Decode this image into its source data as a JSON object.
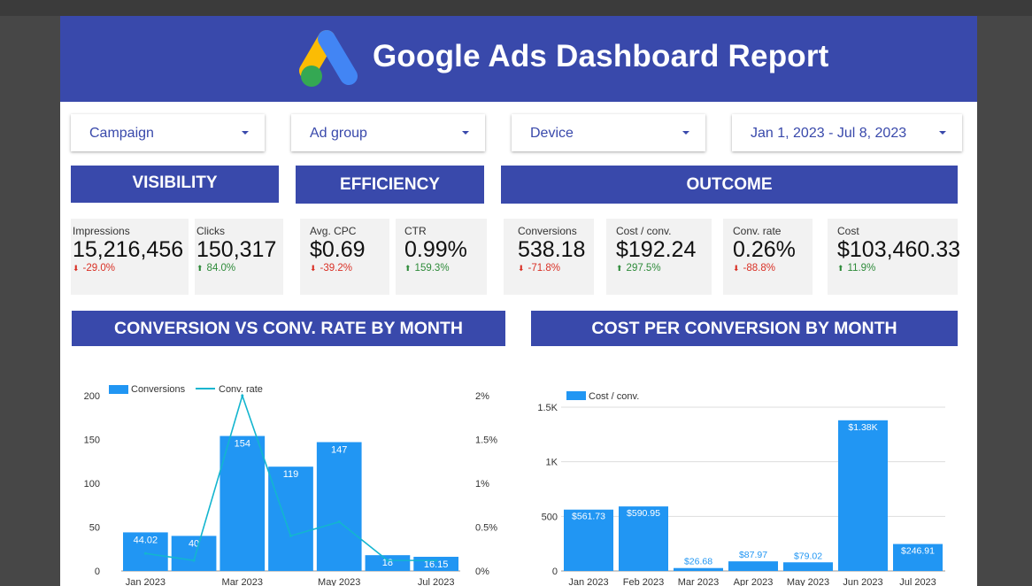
{
  "header": {
    "title": "Google Ads Dashboard Report",
    "logo": "google-ads-logo"
  },
  "filters": [
    {
      "label": "Campaign"
    },
    {
      "label": "Ad group"
    },
    {
      "label": "Device"
    },
    {
      "label": "Jan 1, 2023 - Jul 8, 2023"
    }
  ],
  "sections": {
    "visibility": "VISIBILITY",
    "efficiency": "EFFICIENCY",
    "outcome": "OUTCOME"
  },
  "kpis": [
    {
      "label": "Impressions",
      "value": "15,216,456",
      "delta": "-29.0%",
      "dir": "down"
    },
    {
      "label": "Clicks",
      "value": "150,317",
      "delta": "84.0%",
      "dir": "up"
    },
    {
      "label": "Avg. CPC",
      "value": "$0.69",
      "delta": "-39.2%",
      "dir": "down"
    },
    {
      "label": "CTR",
      "value": "0.99%",
      "delta": "159.3%",
      "dir": "up"
    },
    {
      "label": "Conversions",
      "value": "538.18",
      "delta": "-71.8%",
      "dir": "down"
    },
    {
      "label": "Cost / conv.",
      "value": "$192.24",
      "delta": "297.5%",
      "dir": "up"
    },
    {
      "label": "Conv. rate",
      "value": "0.26%",
      "delta": "-88.8%",
      "dir": "down"
    },
    {
      "label": "Cost",
      "value": "$103,460.33",
      "delta": "11.9%",
      "dir": "up"
    }
  ],
  "colors": {
    "brand": "#3949ab",
    "bar": "#2196f3",
    "line": "#13b5cf",
    "up": "#2e8b3a",
    "down": "#d93025"
  },
  "chart_data": [
    {
      "type": "bar",
      "title": "CONVERSION VS CONV. RATE BY MONTH",
      "categories": [
        "Jan 2023",
        "Feb 2023",
        "Mar 2023",
        "Apr 2023",
        "May 2023",
        "Jun 2023",
        "Jul 2023"
      ],
      "series": [
        {
          "name": "Conversions",
          "type": "bar",
          "axis": "left",
          "values": [
            44.02,
            40,
            154,
            119,
            147,
            18,
            16.15
          ],
          "labels": [
            "44.02",
            "40",
            "154",
            "119",
            "147",
            "18",
            "16.15"
          ]
        },
        {
          "name": "Conv. rate",
          "type": "line",
          "axis": "right",
          "values": [
            0.2,
            0.12,
            2.0,
            0.4,
            0.56,
            0.12,
            0.12
          ]
        }
      ],
      "ylim": [
        0,
        200
      ],
      "yticks": [
        0,
        50,
        100,
        150,
        200
      ],
      "ytick_labels": [
        "0",
        "50",
        "100",
        "150",
        "200"
      ],
      "y2lim": [
        0,
        2
      ],
      "y2ticks": [
        0,
        0.5,
        1,
        1.5,
        2
      ],
      "y2tick_labels": [
        "0%",
        "0.5%",
        "1%",
        "1.5%",
        "2%"
      ],
      "grid": false,
      "legend": "top-left"
    },
    {
      "type": "bar",
      "title": "COST PER CONVERSION BY MONTH",
      "categories": [
        "Jan 2023",
        "Feb 2023",
        "Mar 2023",
        "Apr 2023",
        "May 2023",
        "Jun 2023",
        "Jul 2023"
      ],
      "series": [
        {
          "name": "Cost / conv.",
          "values": [
            561.73,
            590.95,
            26.68,
            87.97,
            79.02,
            1380,
            246.91
          ],
          "labels": [
            "$561.73",
            "$590.95",
            "$26.68",
            "$87.97",
            "$79.02",
            "$1.38K",
            "$246.91"
          ]
        }
      ],
      "ylim": [
        0,
        1500
      ],
      "yticks": [
        0,
        500,
        1000,
        1500
      ],
      "ytick_labels": [
        "0",
        "500",
        "1K",
        "1.5K"
      ],
      "grid": true,
      "legend": "top-left"
    }
  ]
}
